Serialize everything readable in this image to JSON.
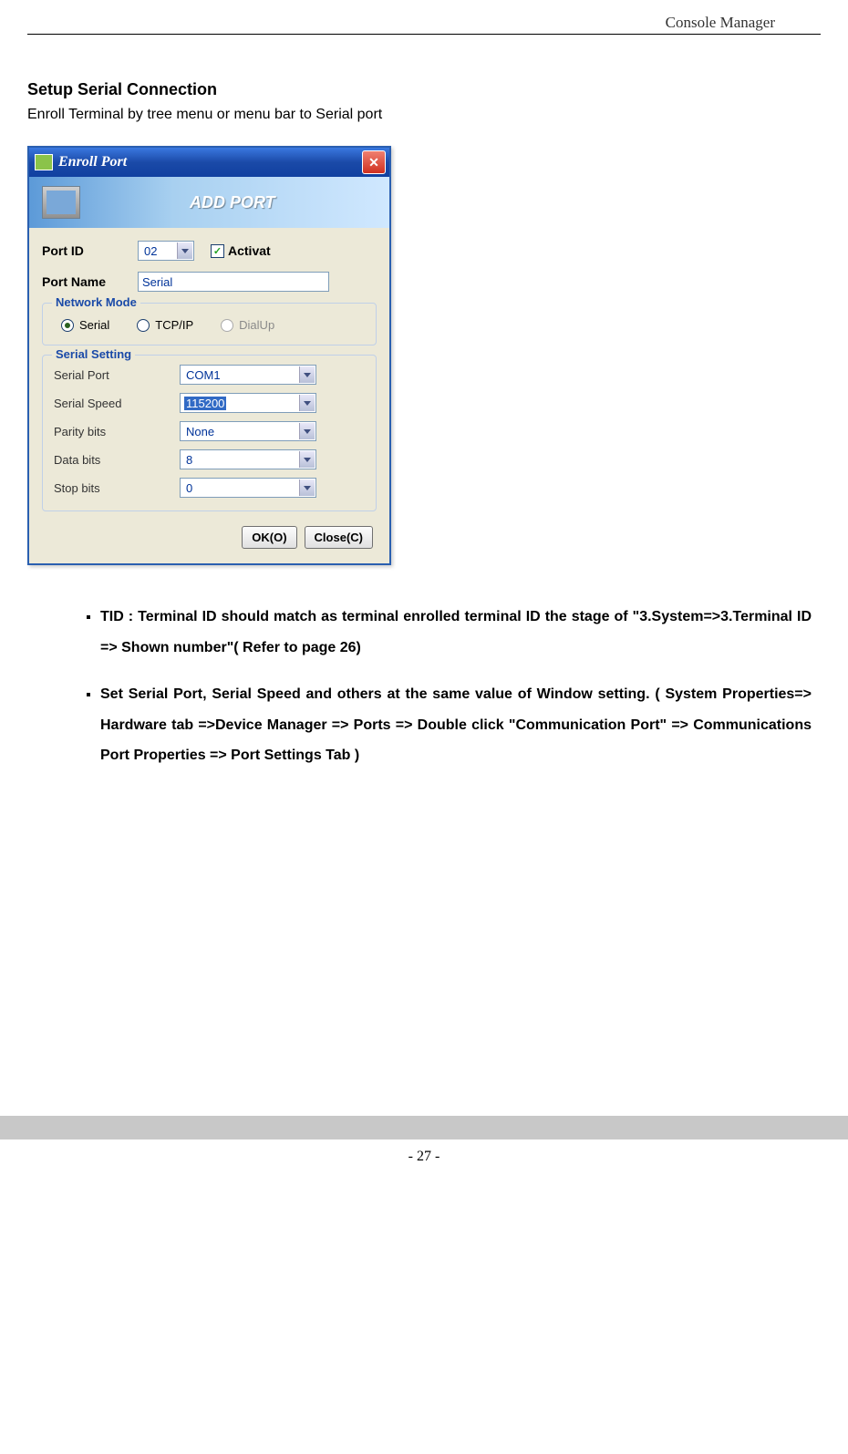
{
  "header": {
    "title": "Console Manager"
  },
  "section": {
    "title": "Setup Serial Connection",
    "desc": "Enroll Terminal by tree menu or menu bar to Serial port"
  },
  "dialog": {
    "title": "Enroll Port",
    "banner": "ADD PORT",
    "portid_label": "Port ID",
    "portid_value": "02",
    "activat_label": "Activat",
    "activat_checked": "✓",
    "portname_label": "Port Name",
    "portname_value": "Serial",
    "network_legend": "Network Mode",
    "radio_serial": "Serial",
    "radio_tcpip": "TCP/IP",
    "radio_dialup": "DialUp",
    "serial_legend": "Serial Setting",
    "rows": {
      "serial_port": {
        "label": "Serial Port",
        "value": "COM1"
      },
      "serial_speed": {
        "label": "Serial Speed",
        "value": "115200"
      },
      "parity": {
        "label": "Parity bits",
        "value": "None"
      },
      "data": {
        "label": "Data bits",
        "value": "8"
      },
      "stop": {
        "label": "Stop bits",
        "value": "0"
      }
    },
    "ok": "OK(O)",
    "close": "Close(C)"
  },
  "bullets": {
    "b1": "TID : Terminal ID should match as terminal enrolled terminal ID the stage of \"3.System=>3.Terminal ID => Shown number\"( Refer to page 26)",
    "b2": "Set Serial Port, Serial Speed and others at the same value of Window setting. ( System Properties=> Hardware tab =>Device Manager => Ports => Double click \"Communication Port\" => Communications Port Properties => Port Settings Tab )"
  },
  "footer": {
    "page": "- 27 -"
  }
}
